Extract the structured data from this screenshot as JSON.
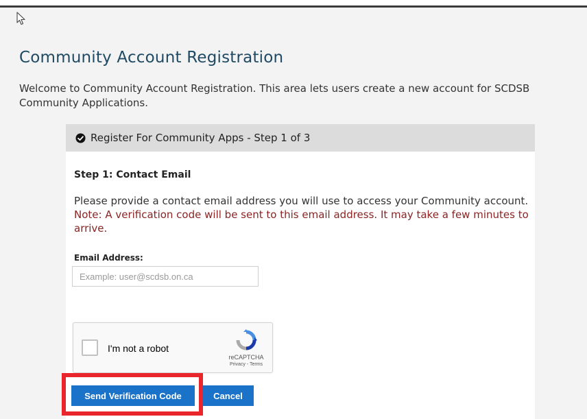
{
  "page": {
    "title": "Community Account Registration",
    "intro": "Welcome to Community Account Registration. This area lets users create a new account for SCDSB Community Applications."
  },
  "card": {
    "header": "Register For Community Apps - Step 1 of 3",
    "step_title": "Step 1: Contact Email",
    "description": "Please provide a contact email address you will use to access your Community account. ",
    "note": "Note: A verification code will be sent to this email address. It may take a few minutes to arrive."
  },
  "form": {
    "email_label": "Email Address:",
    "email_value": "",
    "email_placeholder": "Example: user@scdsb.on.ca"
  },
  "recaptcha": {
    "label": "I'm not a robot",
    "brand": "reCAPTCHA",
    "links": "Privacy - Terms"
  },
  "buttons": {
    "send": "Send Verification Code",
    "cancel": "Cancel"
  },
  "colors": {
    "title": "#1f4a63",
    "note": "#8b2323",
    "button": "#1a73c8",
    "highlight": "#e8262b"
  },
  "icons": {
    "cursor": "mouse-pointer-icon",
    "header": "check-circle-icon",
    "recaptcha": "recaptcha-logo-icon"
  }
}
